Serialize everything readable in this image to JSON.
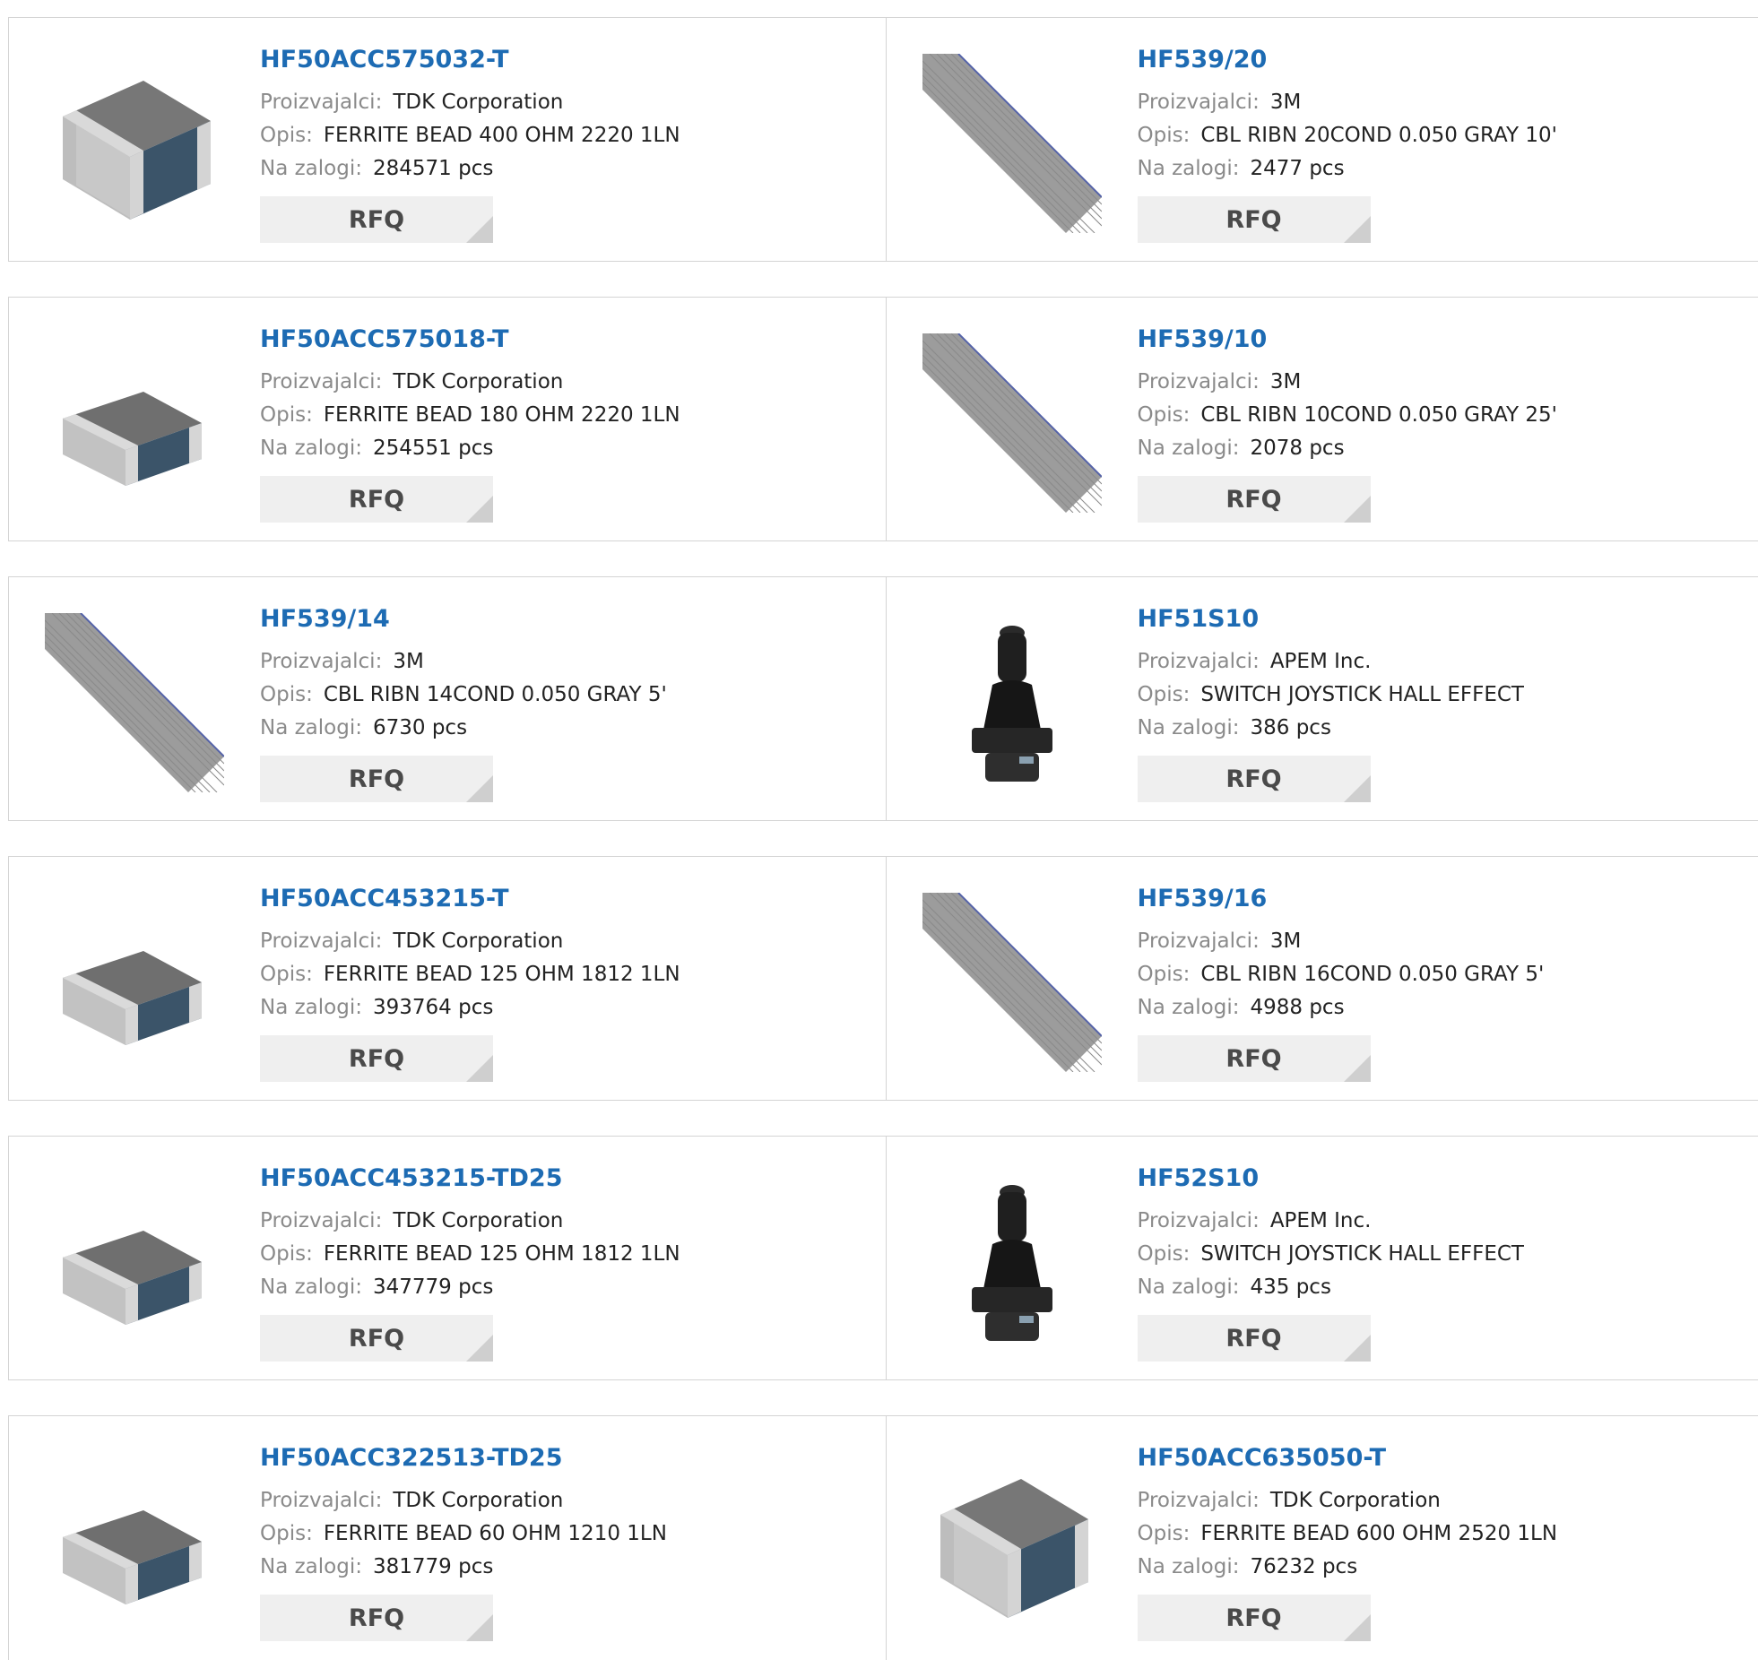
{
  "labels": {
    "manufacturer": "Proizvajalci:",
    "description": "Opis:",
    "stock": "Na zalogi:",
    "rfq": "RFQ"
  },
  "colors": {
    "link": "#1d6bb3",
    "label": "#8a8a8a",
    "button_bg": "#efefef"
  },
  "products": [
    {
      "part": "HF50ACC575032-T",
      "manufacturer": "TDK Corporation",
      "description": "FERRITE BEAD 400 OHM 2220 1LN",
      "stock": "284571 pcs",
      "image": "ferrite-bead-large"
    },
    {
      "part": "HF539/20",
      "manufacturer": "3M",
      "description": "CBL RIBN 20COND 0.050 GRAY 10'",
      "stock": "2477 pcs",
      "image": "ribbon-cable"
    },
    {
      "part": "HF50ACC575018-T",
      "manufacturer": "TDK Corporation",
      "description": "FERRITE BEAD 180 OHM 2220 1LN",
      "stock": "254551 pcs",
      "image": "ferrite-bead"
    },
    {
      "part": "HF539/10",
      "manufacturer": "3M",
      "description": "CBL RIBN 10COND 0.050 GRAY 25'",
      "stock": "2078 pcs",
      "image": "ribbon-cable"
    },
    {
      "part": "HF539/14",
      "manufacturer": "3M",
      "description": "CBL RIBN 14COND 0.050 GRAY 5'",
      "stock": "6730 pcs",
      "image": "ribbon-cable"
    },
    {
      "part": "HF51S10",
      "manufacturer": "APEM Inc.",
      "description": "SWITCH JOYSTICK HALL EFFECT",
      "stock": "386 pcs",
      "image": "joystick"
    },
    {
      "part": "HF50ACC453215-T",
      "manufacturer": "TDK Corporation",
      "description": "FERRITE BEAD 125 OHM 1812 1LN",
      "stock": "393764 pcs",
      "image": "ferrite-bead"
    },
    {
      "part": "HF539/16",
      "manufacturer": "3M",
      "description": "CBL RIBN 16COND 0.050 GRAY 5'",
      "stock": "4988 pcs",
      "image": "ribbon-cable"
    },
    {
      "part": "HF50ACC453215-TD25",
      "manufacturer": "TDK Corporation",
      "description": "FERRITE BEAD 125 OHM 1812 1LN",
      "stock": "347779 pcs",
      "image": "ferrite-bead"
    },
    {
      "part": "HF52S10",
      "manufacturer": "APEM Inc.",
      "description": "SWITCH JOYSTICK HALL EFFECT",
      "stock": "435 pcs",
      "image": "joystick"
    },
    {
      "part": "HF50ACC322513-TD25",
      "manufacturer": "TDK Corporation",
      "description": "FERRITE BEAD 60 OHM 1210 1LN",
      "stock": "381779 pcs",
      "image": "ferrite-bead"
    },
    {
      "part": "HF50ACC635050-T",
      "manufacturer": "TDK Corporation",
      "description": "FERRITE BEAD 600 OHM 2520 1LN",
      "stock": "76232 pcs",
      "image": "ferrite-bead-large"
    }
  ]
}
